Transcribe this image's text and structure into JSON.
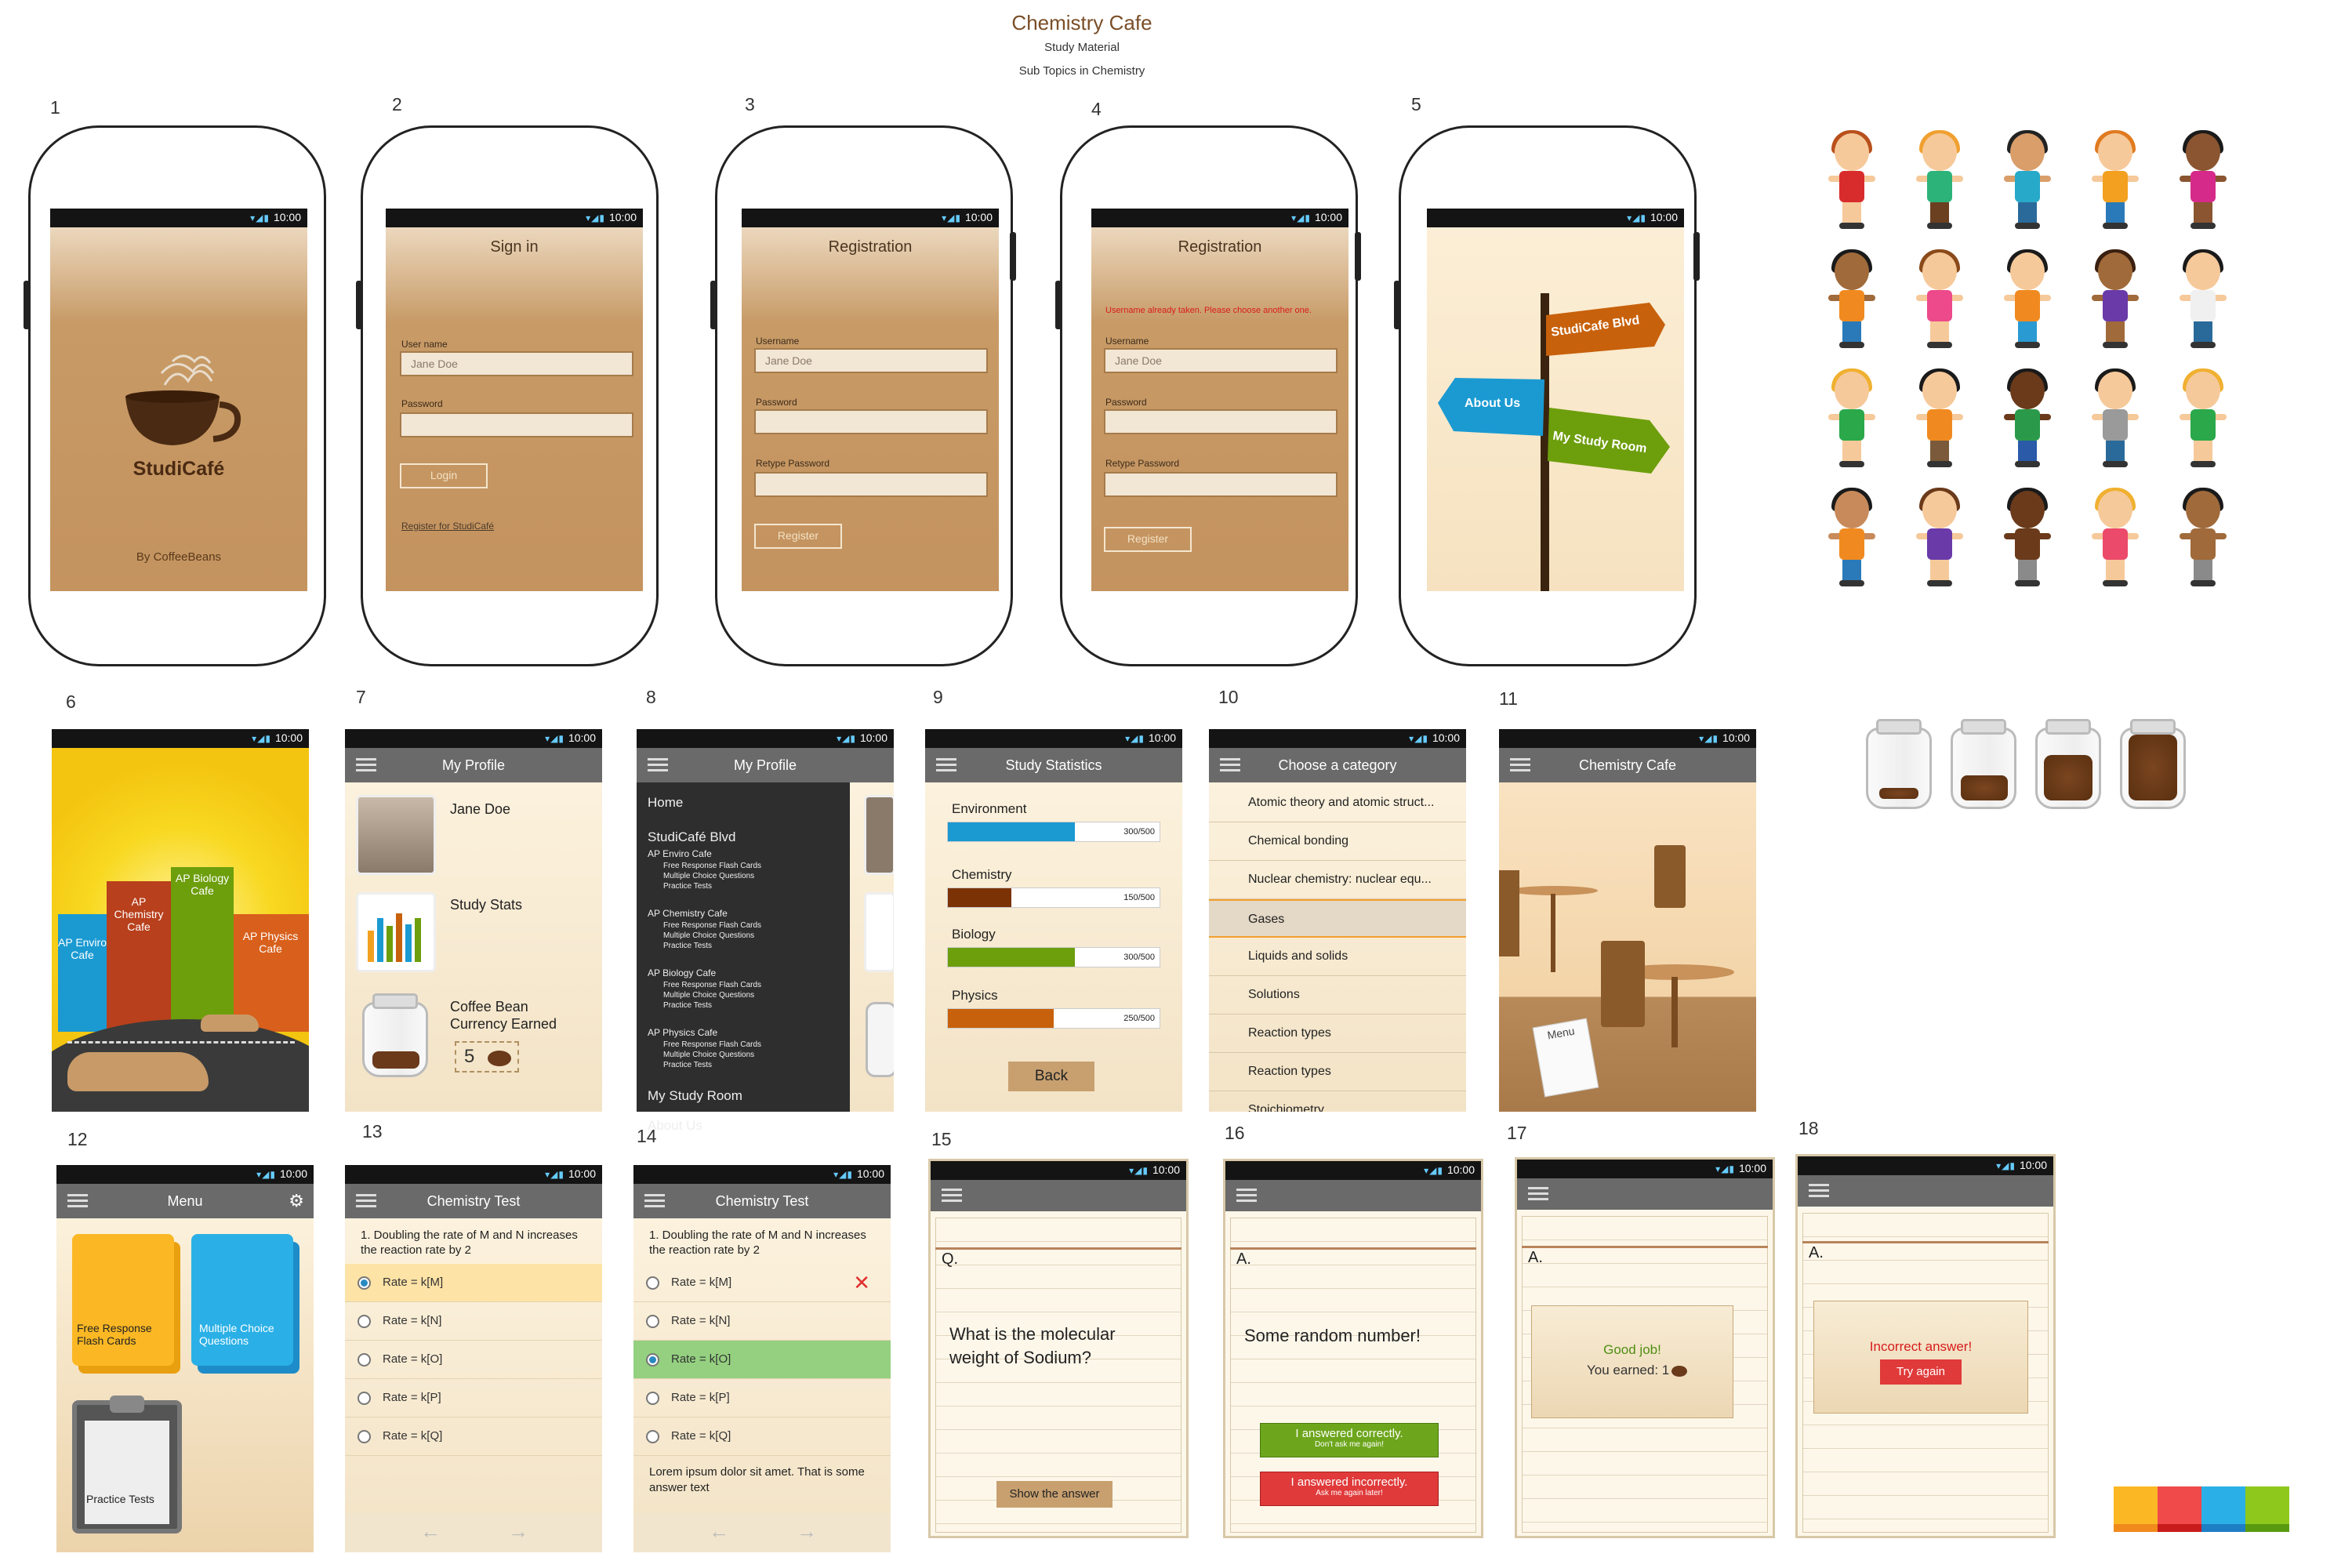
{
  "header": {
    "title": "Chemistry Cafe",
    "subtitle1": "Study Material",
    "subtitle2": "Sub Topics in Chemistry"
  },
  "screen_numbers": [
    "1",
    "2",
    "3",
    "4",
    "5",
    "6",
    "7",
    "8",
    "9",
    "10",
    "11",
    "12",
    "13",
    "14",
    "15",
    "16",
    "17",
    "18"
  ],
  "status": {
    "time": "10:00"
  },
  "s1": {
    "app_name": "StudiCafé",
    "credit": "By CoffeeBeans"
  },
  "s2": {
    "title": "Sign in",
    "user_label": "User name",
    "user_value": "Jane Doe",
    "pass_label": "Password",
    "login": "Login",
    "register_link": "Register for StudiCafé"
  },
  "s3": {
    "title": "Registration",
    "user_label": "Username",
    "user_value": "Jane Doe",
    "pass_label": "Password",
    "retype_label": "Retype Password",
    "register": "Register"
  },
  "s4": {
    "title": "Registration",
    "error": "Username already taken. Please choose another one.",
    "user_label": "Username",
    "user_value": "Jane Doe",
    "pass_label": "Password",
    "retype_label": "Retype Password",
    "register": "Register"
  },
  "s5": {
    "sign_studicafe": "StudiCafe Blvd",
    "sign_about": "About Us",
    "sign_study": "My Study Room"
  },
  "s6": {
    "b_enviro": "AP Enviro Cafe",
    "b_chem": "AP Chemistry Cafe",
    "b_bio": "AP Biology Cafe",
    "b_phys": "AP Physics Cafe"
  },
  "s7": {
    "title": "My Profile",
    "name": "Jane Doe",
    "stats": "Study Stats",
    "currency1": "Coffee Bean",
    "currency2": "Currency Earned",
    "beans": "5"
  },
  "s8": {
    "title": "My Profile",
    "home": "Home",
    "blvd": "StudiCafé Blvd",
    "enviro": "AP Enviro Cafe",
    "chem": "AP Chemistry Cafe",
    "bio": "AP Biology Cafe",
    "phys": "AP Physics Cafe",
    "sub1": "Free Response Flash Cards",
    "sub2": "Multiple Choice Questions",
    "sub3": "Practice Tests",
    "study": "My Study Room",
    "about": "About Us"
  },
  "s9": {
    "title": "Study Statistics",
    "back": "Back",
    "bars": [
      {
        "label": "Environment",
        "text": "300/500",
        "value": 300,
        "max": 500,
        "color": "#1b9ad2"
      },
      {
        "label": "Chemistry",
        "text": "150/500",
        "value": 150,
        "max": 500,
        "color": "#7b3306"
      },
      {
        "label": "Biology",
        "text": "300/500",
        "value": 300,
        "max": 500,
        "color": "#6d9e0c"
      },
      {
        "label": "Physics",
        "text": "250/500",
        "value": 250,
        "max": 500,
        "color": "#c8610c"
      }
    ]
  },
  "s10": {
    "title": "Choose a category",
    "items": [
      "Atomic theory and atomic struct...",
      "Chemical bonding",
      "Nuclear chemistry: nuclear equ...",
      "Gases",
      "Liquids and solids",
      "Solutions",
      "Reaction types",
      "Reaction types",
      "Stoichiometry"
    ]
  },
  "s11": {
    "title": "Chemistry Cafe",
    "menu": "Menu"
  },
  "s12": {
    "title": "Menu",
    "free": "Free Response Flash Cards",
    "mc": "Multiple Choice Questions",
    "practice": "Practice Tests"
  },
  "s13": {
    "title": "Chemistry Test",
    "question": "1. Doubling the rate of M and N increases the reaction rate by 2",
    "options": [
      "Rate = k[M]",
      "Rate = k[N]",
      "Rate = k[O]",
      "Rate = k[P]",
      "Rate = k[Q]"
    ]
  },
  "s14": {
    "title": "Chemistry Test",
    "question": "1. Doubling the rate of M and N increases the reaction rate by 2",
    "options": [
      "Rate = k[M]",
      "Rate = k[N]",
      "Rate = k[O]",
      "Rate = k[P]",
      "Rate = k[Q]"
    ],
    "explanation": "Lorem ipsum dolor sit amet. That is some answer text"
  },
  "s15": {
    "prefix": "Q.",
    "question": "What is the molecular weight of Sodium?",
    "show": "Show the answer"
  },
  "s16": {
    "prefix": "A.",
    "answer": "Some random number!",
    "correct": "I answered correctly.",
    "correct_sub": "Don't ask me again!",
    "incorrect": "I answered incorrectly.",
    "incorrect_sub": "Ask me again later!"
  },
  "s17": {
    "prefix": "A.",
    "good": "Good job!",
    "earned": "You earned: 1"
  },
  "s18": {
    "prefix": "A.",
    "incorrect": "Incorrect answer!",
    "retry": "Try again"
  }
}
